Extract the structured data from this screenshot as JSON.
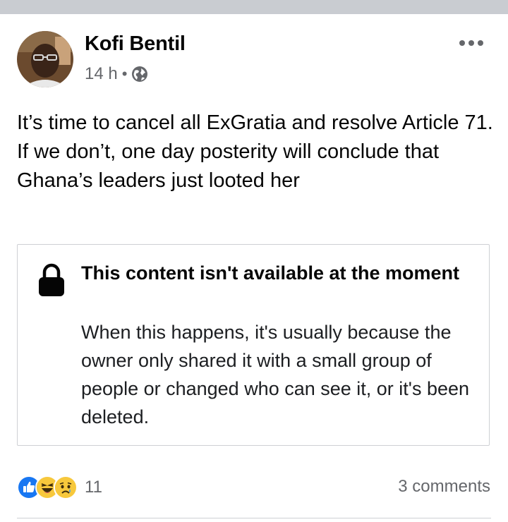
{
  "post": {
    "author": "Kofi Bentil",
    "time": "14 h",
    "separator": "•",
    "audience_icon": "globe-icon",
    "more_icon": "more-options-icon",
    "text": "It’s time to cancel all ExGratia and resolve Article 71.\nIf we don’t, one day posterity will conclude that Ghana’s leaders just looted her"
  },
  "shared_content": {
    "icon": "lock-icon",
    "title": "This content isn't available at the moment",
    "body": "When this happens, it's usually because the owner only shared it with a small group of people or changed who can see it, or it's been deleted."
  },
  "footer": {
    "reaction_icons": [
      "like-reaction-icon",
      "haha-reaction-icon",
      "sad-reaction-icon"
    ],
    "reaction_count": "11",
    "comments": "3 comments"
  },
  "colors": {
    "like_blue": "#1877f2",
    "emoji_yellow": "#f7c83c",
    "secondary_text": "#65676b",
    "border": "#ced0d4"
  }
}
